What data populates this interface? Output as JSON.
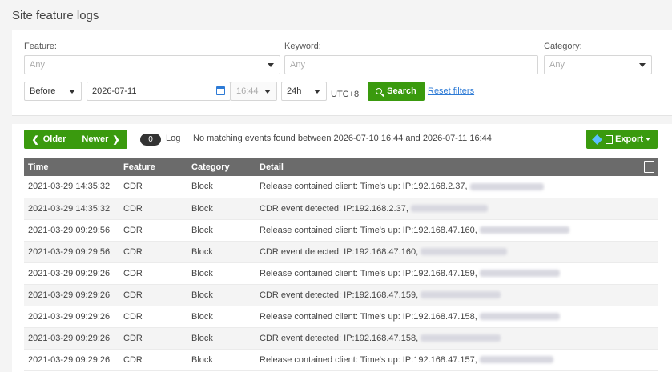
{
  "page": {
    "title": "Site feature logs"
  },
  "filters": {
    "feature_label": "Feature:",
    "feature_value": "Any",
    "keyword_label": "Keyword:",
    "keyword_placeholder": "Any",
    "category_label": "Category:",
    "category_value": "Any",
    "when_value": "Before",
    "date_value": "2026-07-11",
    "time_value": "16:44",
    "range_value": "24h",
    "timezone": "UTC+8",
    "search_label": "Search",
    "reset_label": "Reset filters"
  },
  "results": {
    "older_label": "Older",
    "newer_label": "Newer",
    "count": "0",
    "count_label": "Log",
    "message": "No matching events found between 2026-07-10 16:44 and 2026-07-11 16:44",
    "export_label": "Export",
    "columns": {
      "time": "Time",
      "feature": "Feature",
      "category": "Category",
      "detail": "Detail"
    },
    "rows": [
      {
        "time": "2021-03-29 14:35:32",
        "feature": "CDR",
        "category": "Block",
        "detail": "Release contained client: Time's up: IP:192.168.2.37,"
      },
      {
        "time": "2021-03-29 14:35:32",
        "feature": "CDR",
        "category": "Block",
        "detail": "CDR event detected: IP:192.168.2.37,"
      },
      {
        "time": "2021-03-29 09:29:56",
        "feature": "CDR",
        "category": "Block",
        "detail": "Release contained client: Time's up: IP:192.168.47.160,"
      },
      {
        "time": "2021-03-29 09:29:56",
        "feature": "CDR",
        "category": "Block",
        "detail": "CDR event detected: IP:192.168.47.160,"
      },
      {
        "time": "2021-03-29 09:29:26",
        "feature": "CDR",
        "category": "Block",
        "detail": "Release contained client: Time's up: IP:192.168.47.159,"
      },
      {
        "time": "2021-03-29 09:29:26",
        "feature": "CDR",
        "category": "Block",
        "detail": "CDR event detected: IP:192.168.47.159,"
      },
      {
        "time": "2021-03-29 09:29:26",
        "feature": "CDR",
        "category": "Block",
        "detail": "Release contained client: Time's up: IP:192.168.47.158,"
      },
      {
        "time": "2021-03-29 09:29:26",
        "feature": "CDR",
        "category": "Block",
        "detail": "CDR event detected: IP:192.168.47.158,"
      },
      {
        "time": "2021-03-29 09:29:26",
        "feature": "CDR",
        "category": "Block",
        "detail": "Release contained client: Time's up: IP:192.168.47.157,"
      }
    ]
  }
}
